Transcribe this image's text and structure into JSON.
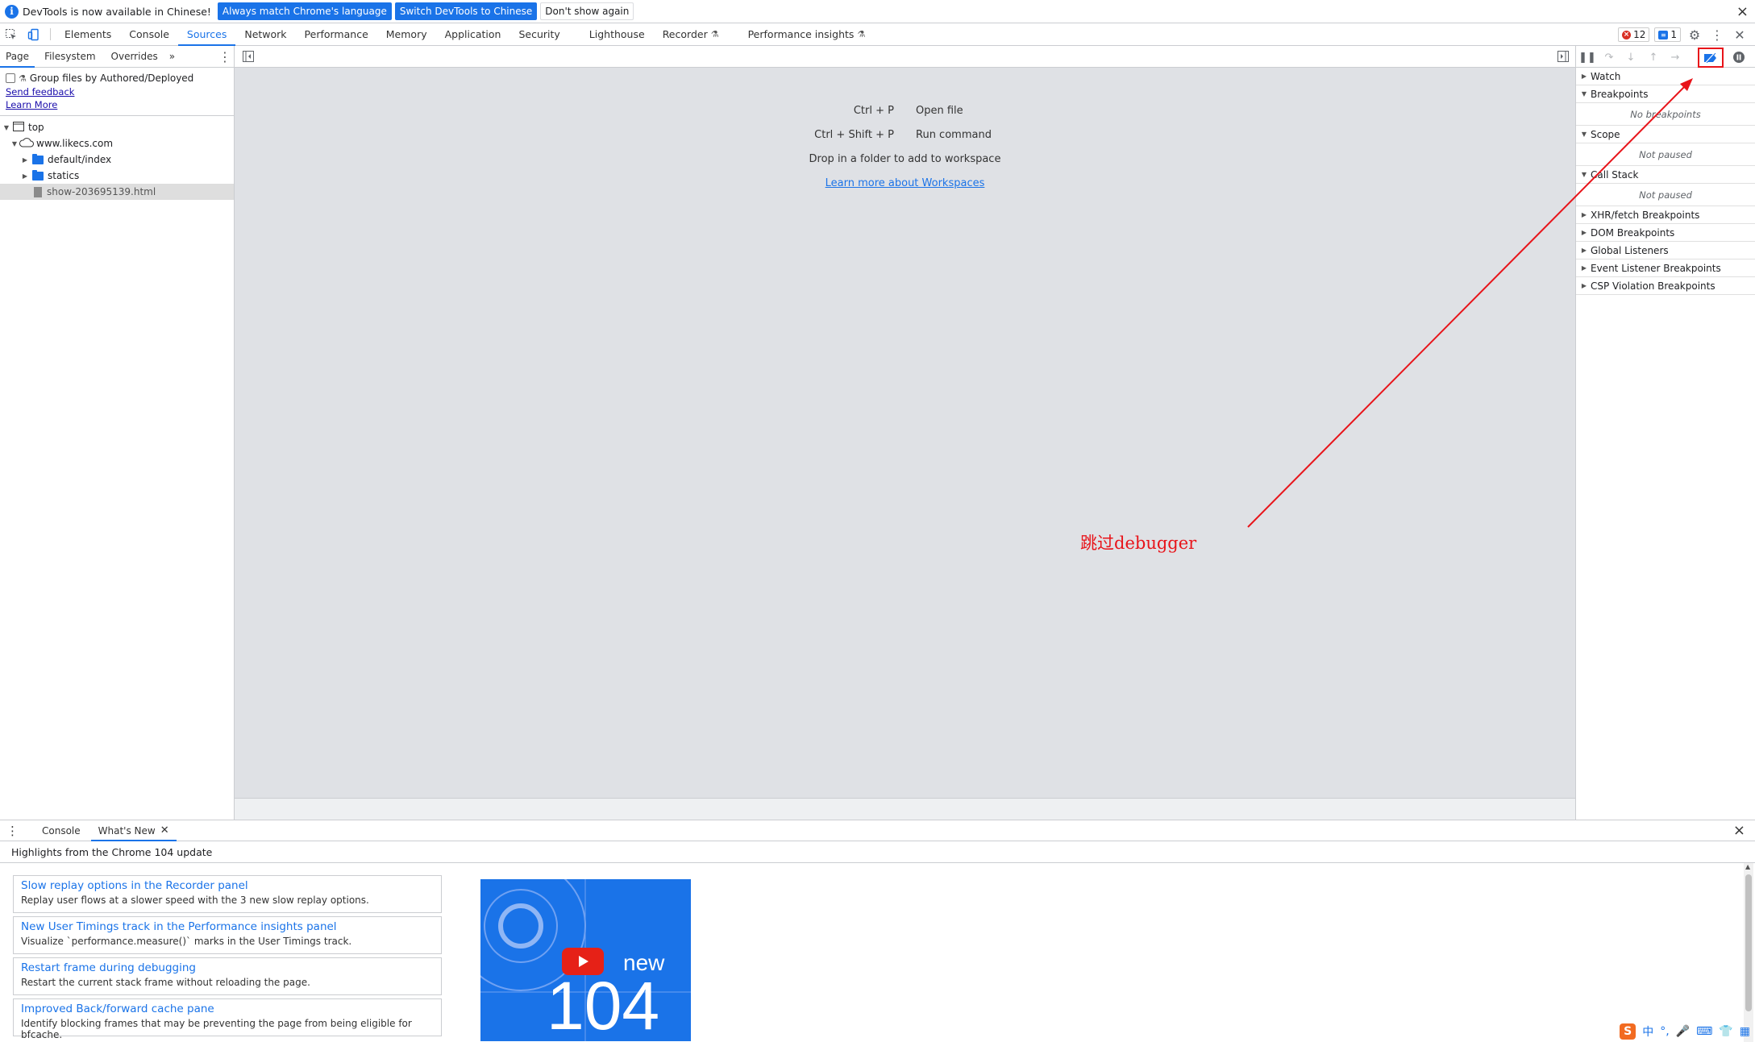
{
  "infobar": {
    "message": "DevTools is now available in Chinese!",
    "btn_match": "Always match Chrome's language",
    "btn_switch": "Switch DevTools to Chinese",
    "btn_dismiss": "Don't show again",
    "close": "×"
  },
  "main_tabs": [
    "Elements",
    "Console",
    "Sources",
    "Network",
    "Performance",
    "Memory",
    "Application",
    "Security",
    "Lighthouse",
    "Recorder",
    "Performance insights"
  ],
  "active_tab": "Sources",
  "counters": {
    "errors": "12",
    "messages": "1"
  },
  "navigator": {
    "tabs": [
      "Page",
      "Filesystem",
      "Overrides"
    ],
    "more": "»",
    "group_files_label": "Group files by Authored/Deployed",
    "send_feedback": "Send feedback",
    "learn_more": "Learn More",
    "tree": {
      "top": "top",
      "domain": "www.likecs.com",
      "folder1": "default/index",
      "folder2": "statics",
      "file": "show-203695139.html"
    }
  },
  "editor": {
    "shortcuts": [
      {
        "key": "Ctrl + P",
        "action": "Open file"
      },
      {
        "key": "Ctrl + Shift + P",
        "action": "Run command"
      }
    ],
    "drop_text": "Drop in a folder to add to workspace",
    "workspace_link": "Learn more about Workspaces",
    "annotation": "跳过debugger"
  },
  "debugger": {
    "sections": {
      "watch": "Watch",
      "breakpoints": "Breakpoints",
      "no_breakpoints": "No breakpoints",
      "scope": "Scope",
      "not_paused_scope": "Not paused",
      "call_stack": "Call Stack",
      "not_paused_stack": "Not paused",
      "xhr": "XHR/fetch Breakpoints",
      "dom": "DOM Breakpoints",
      "global": "Global Listeners",
      "event": "Event Listener Breakpoints",
      "csp": "CSP Violation Breakpoints"
    }
  },
  "drawer": {
    "tabs": {
      "console": "Console",
      "whats_new": "What's New"
    },
    "close": "×",
    "highlights": "Highlights from the Chrome 104 update",
    "cards": [
      {
        "title": "Slow replay options in the Recorder panel",
        "desc": "Replay user flows at a slower speed with the 3 new slow replay options."
      },
      {
        "title": "New User Timings track in the Performance insights panel",
        "desc": "Visualize `performance.measure()` marks in the User Timings track."
      },
      {
        "title": "Restart frame during debugging",
        "desc": "Restart the current stack frame without reloading the page."
      },
      {
        "title": "Improved Back/forward cache pane",
        "desc": "Identify blocking frames that may be preventing the page from being eligible for bfcache."
      }
    ],
    "video": {
      "label_new": "new",
      "label_version": "104"
    }
  },
  "ime": {
    "logo": "S",
    "lang": "中"
  },
  "colors": {
    "accent": "#1a73e8",
    "annotation": "#e8141a",
    "error": "#d93025"
  }
}
